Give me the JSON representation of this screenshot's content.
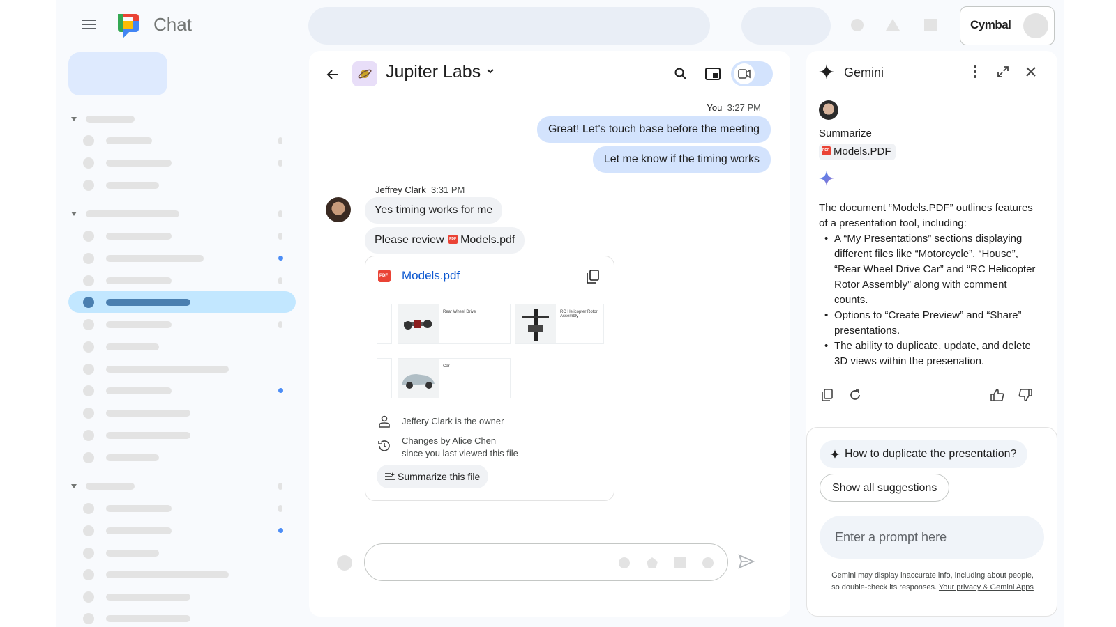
{
  "app": {
    "name": "Chat",
    "account_brand": "Cymbal"
  },
  "colors": {
    "accent": "#0b57d0",
    "bubble_you": "#d3e3fd",
    "sidebar_active": "#c2e7ff",
    "pdf_red": "#ea4335"
  },
  "chat": {
    "space_name": "Jupiter Labs",
    "messages_you": {
      "sender": "You",
      "time": "3:27 PM",
      "lines": [
        "Great! Let’s touch base before the meeting",
        "Let me know if the timing works"
      ]
    },
    "messages_them": {
      "sender": "Jeffrey Clark",
      "time": "3:31 PM",
      "line1": "Yes timing works for me",
      "line2_prefix": "Please review",
      "attachment_name": "Models.pdf"
    },
    "file_card": {
      "title": "Models.pdf",
      "thumbs": [
        "Rear Wheel Drive",
        "RC Helicopter Rotor Assembly",
        "Car"
      ],
      "owner_text": "Jeffery Clark is the owner",
      "changes_line1": "Changes by Alice Chen",
      "changes_line2": "since you last viewed this file",
      "summarize_label": "Summarize this file"
    }
  },
  "gemini": {
    "title": "Gemini",
    "prompt": "Summarize",
    "prompt_file": "Models.PDF",
    "response_intro": "The document “Models.PDF” outlines features of a presentation tool, including:",
    "bullets": [
      "A “My Presentations” sections displaying different files like “Motorcycle”, “House”, “Rear Wheel Drive Car” and “RC Helicopter Rotor Assembly” along with comment counts.",
      "Options to “Create Preview” and “Share” presentations.",
      "The ability to duplicate, update, and delete 3D views within the presenation."
    ],
    "suggestion": "How to duplicate the presentation?",
    "show_all": "Show all suggestions",
    "input_placeholder": "Enter a prompt here",
    "disclaimer_line1": "Gemini may display inaccurate info, including about people,",
    "disclaimer_line2": "so double-check its responses.",
    "disclaimer_link": "Your privacy & Gemini Apps"
  }
}
